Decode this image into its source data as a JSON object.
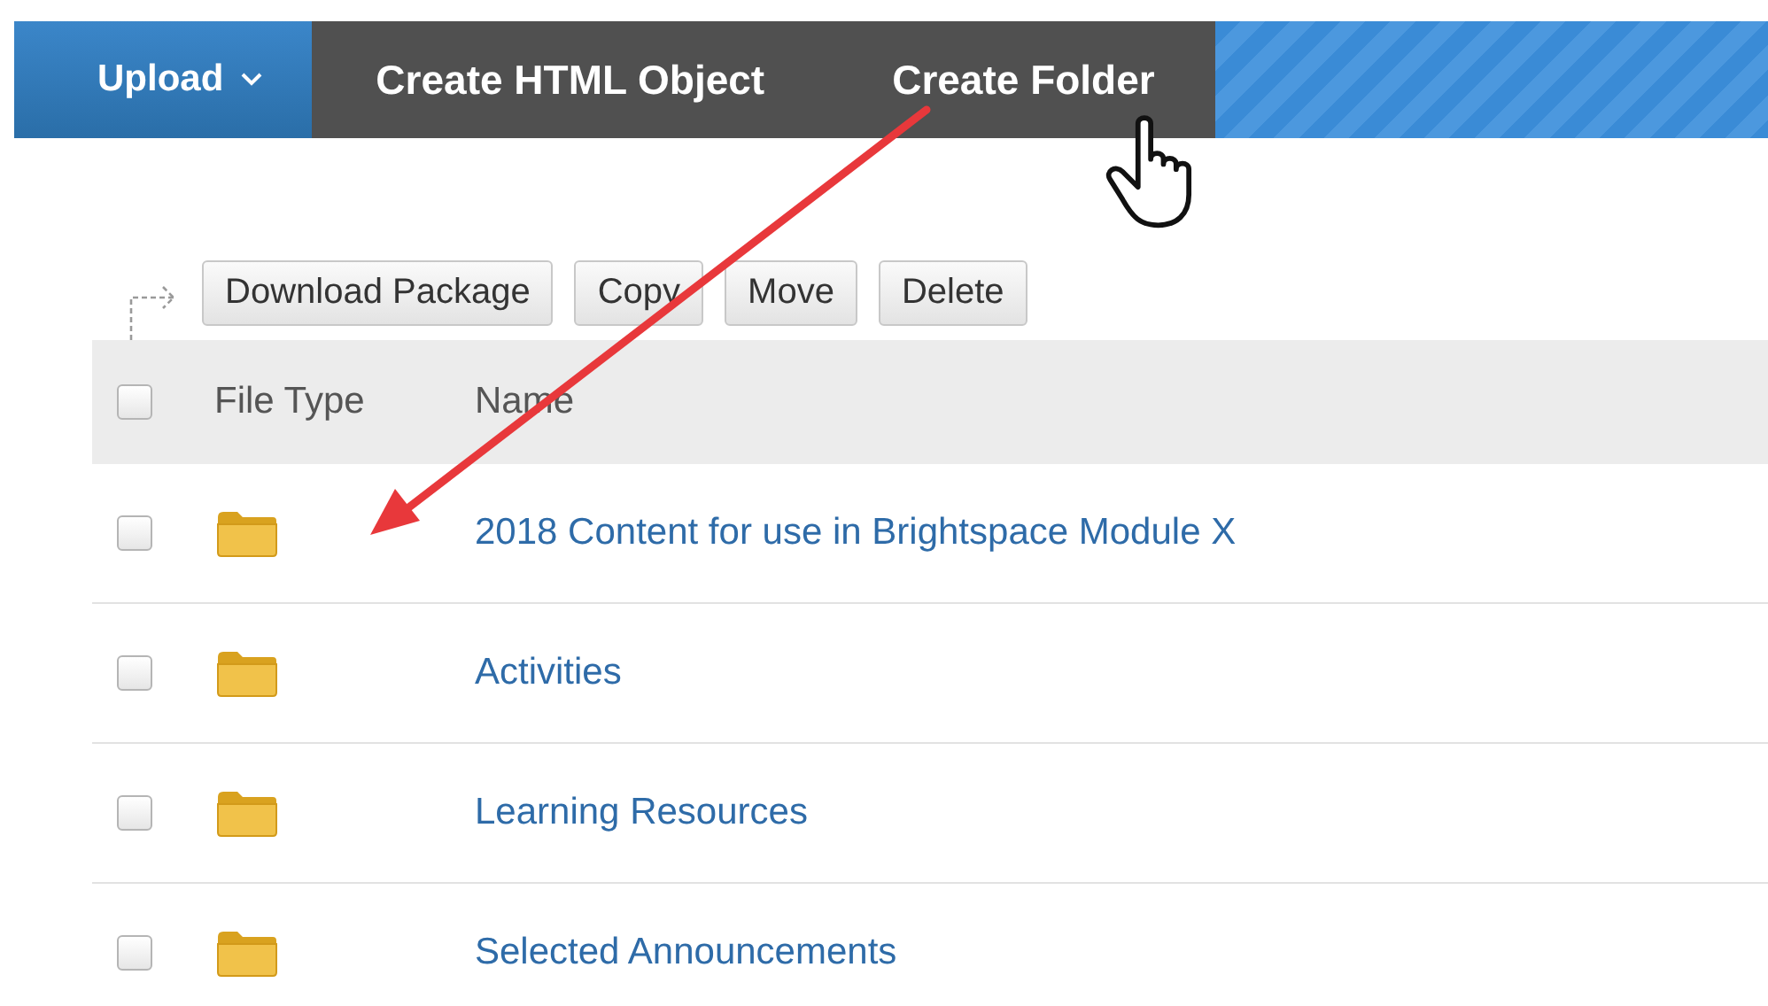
{
  "menu_bar": [
    {
      "label": "Upload",
      "kind": "dropdown"
    },
    {
      "label": "Create HTML Object",
      "kind": "action"
    },
    {
      "label": "Create Folder",
      "kind": "action"
    }
  ],
  "toolbar": {
    "buttons": [
      "Download Package",
      "Copy",
      "Move",
      "Delete"
    ]
  },
  "table": {
    "select_all": {
      "checked": false
    },
    "columns": [
      "File Type",
      "Name"
    ],
    "rows": [
      {
        "checked": false,
        "kind": "folder",
        "name": "2018 Content for use in Brightspace Module X"
      },
      {
        "checked": false,
        "kind": "folder",
        "name": "Activities"
      },
      {
        "checked": false,
        "kind": "folder",
        "name": "Learning Resources"
      },
      {
        "checked": false,
        "kind": "folder",
        "name": "Selected Announcements"
      }
    ]
  }
}
